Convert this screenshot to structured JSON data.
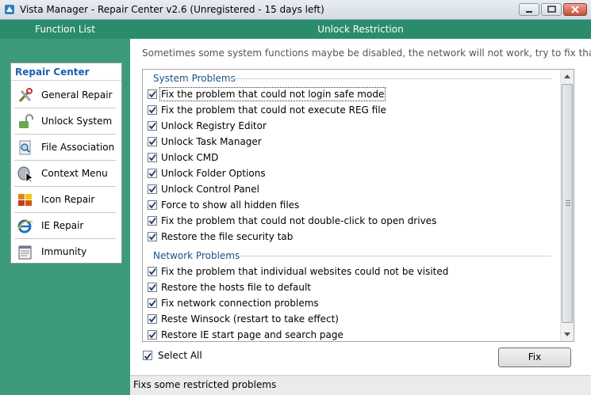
{
  "window": {
    "title": "Vista Manager - Repair Center v2.6 (Unregistered - 15 days left)"
  },
  "left": {
    "header": "Function List",
    "nav_title": "Repair Center",
    "items": [
      {
        "label": "General Repair",
        "icon": "tools-icon"
      },
      {
        "label": "Unlock System",
        "icon": "unlock-icon"
      },
      {
        "label": "File Association",
        "icon": "file-search-icon"
      },
      {
        "label": "Context Menu",
        "icon": "mouse-cursor-icon"
      },
      {
        "label": "Icon Repair",
        "icon": "icon-grid-icon"
      },
      {
        "label": "IE Repair",
        "icon": "ie-icon"
      },
      {
        "label": "Immunity",
        "icon": "notepad-icon"
      }
    ]
  },
  "main": {
    "header": "Unlock Restriction",
    "description": "Sometimes some system functions maybe be disabled, the network will not work, try to fix that.",
    "groups": [
      {
        "title": "System Problems",
        "items": [
          {
            "label": "Fix the problem that could not login safe mode",
            "checked": true
          },
          {
            "label": "Fix the problem that could not execute REG file",
            "checked": true
          },
          {
            "label": "Unlock Registry Editor",
            "checked": true
          },
          {
            "label": "Unlock Task Manager",
            "checked": true
          },
          {
            "label": "Unlock CMD",
            "checked": true
          },
          {
            "label": "Unlock Folder Options",
            "checked": true
          },
          {
            "label": "Unlock Control Panel",
            "checked": true
          },
          {
            "label": "Force to show all hidden files",
            "checked": true
          },
          {
            "label": "Fix the problem that could not double-click to open drives",
            "checked": true
          },
          {
            "label": "Restore the file security tab",
            "checked": true
          }
        ]
      },
      {
        "title": "Network Problems",
        "items": [
          {
            "label": "Fix the problem that individual websites could not be visited",
            "checked": true
          },
          {
            "label": "Restore the hosts file to default",
            "checked": true
          },
          {
            "label": "Fix network connection problems",
            "checked": true
          },
          {
            "label": "Reste Winsock (restart to take effect)",
            "checked": true
          },
          {
            "label": "Restore IE start page and search page",
            "checked": true
          }
        ]
      }
    ],
    "select_all_label": "Select All",
    "fix_label": "Fix"
  },
  "status": {
    "text": "Fixs some restricted problems"
  },
  "colors": {
    "accent_green": "#2a8c6a",
    "panel_green": "#3c9a78",
    "nav_title_blue": "#1a5fb4",
    "group_title_blue": "#1f4e8a"
  }
}
